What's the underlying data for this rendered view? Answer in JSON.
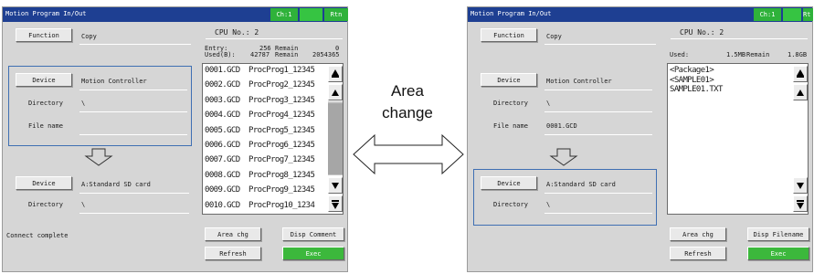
{
  "left": {
    "title": "Motion Program In/Out",
    "ch": "Ch:1",
    "rtn": "Rtn",
    "function_label": "Function",
    "function_value": "Copy",
    "cpu_label": "CPU No.: 2",
    "entry_label": "Entry:",
    "used_label": "Used(B):",
    "entry_value": "256",
    "entry_remain_label": "Remain",
    "entry_remain_value": "0",
    "used_value": "42787",
    "used_remain_label": "Remain",
    "used_remain_value": "2054365",
    "src_device_label": "Device",
    "src_device_value": "Motion Controller",
    "src_directory_label": "Directory",
    "src_directory_value": "\\",
    "file_name_label": "File name",
    "file_name_value": "",
    "dst_device_label": "Device",
    "dst_device_value": "A:Standard SD card",
    "dst_directory_label": "Directory",
    "dst_directory_value": "\\",
    "status": "Connect complete",
    "area_chg": "Area chg",
    "disp_toggle": "Disp Comment",
    "refresh": "Refresh",
    "exec": "Exec",
    "files": [
      {
        "name": "0001.GCD",
        "comment": "ProcProg1_12345"
      },
      {
        "name": "0002.GCD",
        "comment": "ProcProg2_12345"
      },
      {
        "name": "0003.GCD",
        "comment": "ProcProg3_12345"
      },
      {
        "name": "0004.GCD",
        "comment": "ProcProg4_12345"
      },
      {
        "name": "0005.GCD",
        "comment": "ProcProg5_12345"
      },
      {
        "name": "0006.GCD",
        "comment": "ProcProg6_12345"
      },
      {
        "name": "0007.GCD",
        "comment": "ProcProg7_12345"
      },
      {
        "name": "0008.GCD",
        "comment": "ProcProg8_12345"
      },
      {
        "name": "0009.GCD",
        "comment": "ProcProg9_12345"
      },
      {
        "name": "0010.GCD",
        "comment": "ProcProg10_1234"
      }
    ]
  },
  "right": {
    "title": "Motion Program In/Out",
    "ch": "Ch:1",
    "rtn": "Rt",
    "function_label": "Function",
    "function_value": "Copy",
    "cpu_label": "CPU No.: 2",
    "used_label": "Used:",
    "used_value": "1.5MB",
    "used_remain_label": "Remain",
    "used_remain_value": "1.8GB",
    "src_device_label": "Device",
    "src_device_value": "Motion Controller",
    "src_directory_label": "Directory",
    "src_directory_value": "\\",
    "file_name_label": "File name",
    "file_name_value": "0001.GCD",
    "dst_device_label": "Device",
    "dst_device_value": "A:Standard SD card",
    "dst_directory_label": "Directory",
    "dst_directory_value": "\\",
    "area_chg": "Area chg",
    "disp_toggle": "Disp Filename",
    "refresh": "Refresh",
    "exec": "Exec",
    "files": [
      "<Package1>",
      "<SAMPLE01>",
      "SAMPLE01.TXT"
    ]
  },
  "annotation": {
    "line1": "Area",
    "line2": "change"
  },
  "colors": {
    "titlebar": "#1e3f92",
    "accent_green": "#3cb83c",
    "panel_gray": "#d6d6d6",
    "focus_box": "#3f6fb3"
  }
}
